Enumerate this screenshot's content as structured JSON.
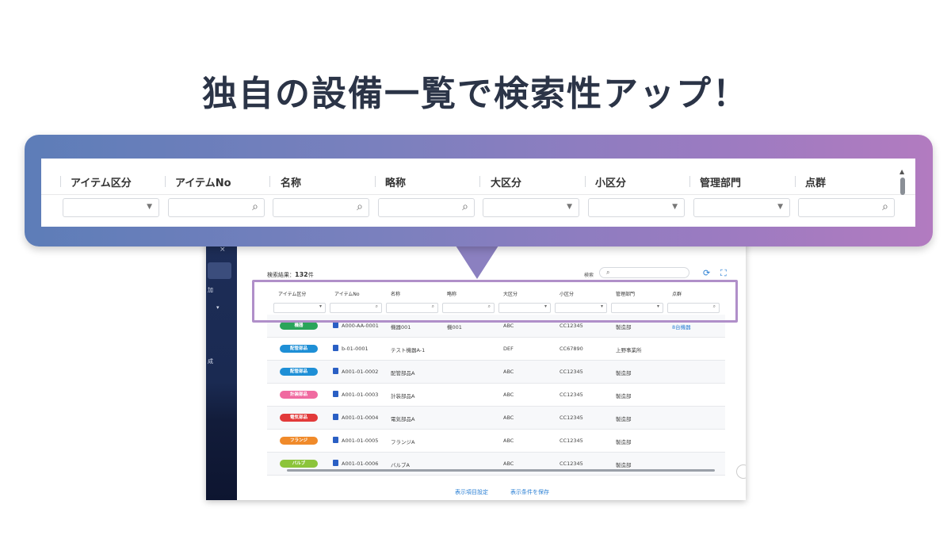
{
  "headline": "独自の設備一覧で検索性アップ！",
  "callout": {
    "columns": [
      "アイテム区分",
      "アイテムNo",
      "名称",
      "略称",
      "大区分",
      "小区分",
      "管理部門",
      "点群"
    ],
    "filter_types": [
      "select",
      "search",
      "search",
      "search",
      "select",
      "select",
      "select",
      "search"
    ]
  },
  "screen": {
    "sidebar": {
      "close": "×",
      "item1": "加",
      "caret": "▾",
      "item2": "成"
    },
    "result_label": "検索結果：",
    "result_count": "132",
    "result_unit": "件",
    "search_label": "検索",
    "refresh_icon": "⟳",
    "fullscreen_icon": "⛶",
    "columns": [
      "アイテム区分",
      "アイテムNo",
      "名称",
      "略称",
      "大区分",
      "小区分",
      "管理部門",
      "点群"
    ],
    "rows": [
      {
        "tag": "機器",
        "tag_color": "#2aa45a",
        "no": "A000-AA-0001",
        "name": "機器001",
        "abbr": "機001",
        "major": "ABC",
        "minor": "CC12345",
        "dept": "製造部",
        "points": "8台機器"
      },
      {
        "tag": "配管部品",
        "tag_color": "#1e8fd6",
        "no": "b-01-0001",
        "name": "テスト機器A-1",
        "abbr": "",
        "major": "DEF",
        "minor": "CC67890",
        "dept": "上野事業所",
        "points": ""
      },
      {
        "tag": "配管部品",
        "tag_color": "#1e8fd6",
        "no": "A001-01-0002",
        "name": "配管部品A",
        "abbr": "",
        "major": "ABC",
        "minor": "CC12345",
        "dept": "製造部",
        "points": ""
      },
      {
        "tag": "計装部品",
        "tag_color": "#f06aa0",
        "no": "A001-01-0003",
        "name": "計装部品A",
        "abbr": "",
        "major": "ABC",
        "minor": "CC12345",
        "dept": "製造部",
        "points": ""
      },
      {
        "tag": "電気部品",
        "tag_color": "#e23a3a",
        "no": "A001-01-0004",
        "name": "電気部品A",
        "abbr": "",
        "major": "ABC",
        "minor": "CC12345",
        "dept": "製造部",
        "points": ""
      },
      {
        "tag": "フランジ",
        "tag_color": "#f08a2a",
        "no": "A001-01-0005",
        "name": "フランジA",
        "abbr": "",
        "major": "ABC",
        "minor": "CC12345",
        "dept": "製造部",
        "points": ""
      },
      {
        "tag": "バルブ",
        "tag_color": "#8cc43a",
        "no": "A001-01-0006",
        "name": "バルブA",
        "abbr": "",
        "major": "ABC",
        "minor": "CC12345",
        "dept": "製造部",
        "points": ""
      }
    ],
    "footer": {
      "display_settings": "表示項目設定",
      "save_conditions": "表示条件を保存"
    }
  },
  "accent_colors": {
    "highlight_border": "#b08fc9",
    "link": "#2a7fd4",
    "sidebar": "#1d2d57"
  }
}
